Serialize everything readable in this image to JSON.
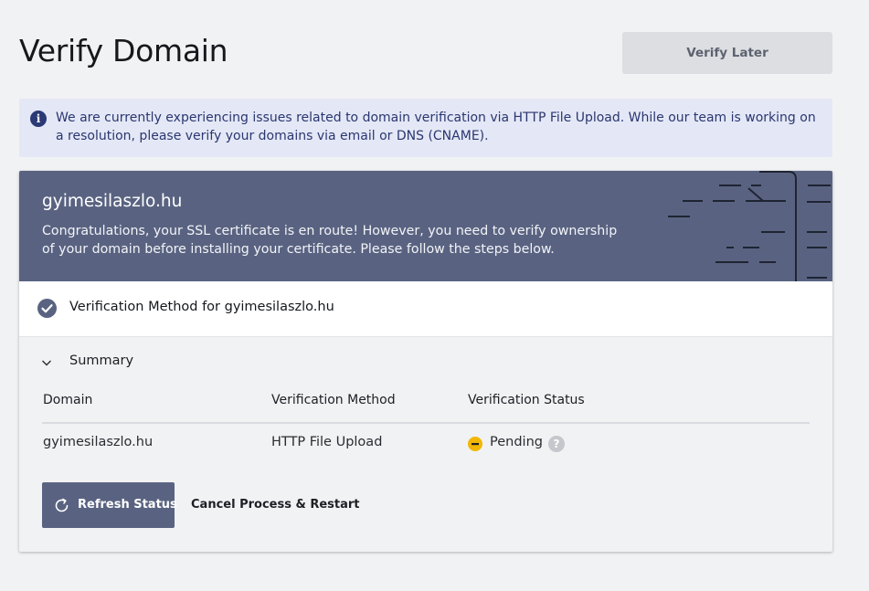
{
  "page": {
    "title": "Verify Domain",
    "verify_later_label": "Verify Later"
  },
  "alert": {
    "icon": "info-icon",
    "text": "We are currently experiencing issues related to domain verification via HTTP File Upload. While our team is working on a resolution, please verify your domains via email or DNS (CNAME)."
  },
  "banner": {
    "domain": "gyimesilaszlo.hu",
    "message": "Congratulations, your SSL certificate is en route! However, you need to verify ownership of your domain before installing your certificate. Please follow the steps below."
  },
  "method_row": {
    "icon": "check-circle-icon",
    "label": "Verification Method for gyimesilaszlo.hu"
  },
  "summary": {
    "label": "Summary",
    "expanded": true,
    "columns": [
      "Domain",
      "Verification Method",
      "Verification Status"
    ],
    "rows": [
      {
        "domain": "gyimesilaszlo.hu",
        "method": "HTTP File Upload",
        "status": "Pending"
      }
    ]
  },
  "actions": {
    "refresh_label": "Refresh Status",
    "cancel_label": "Cancel Process & Restart"
  },
  "colors": {
    "background": "#f1f2f4",
    "banner": "#596381",
    "alert_bg": "#e4e8f6",
    "alert_text": "#2a3670",
    "pending": "#f2b705",
    "button_secondary": "#dcdee2"
  }
}
